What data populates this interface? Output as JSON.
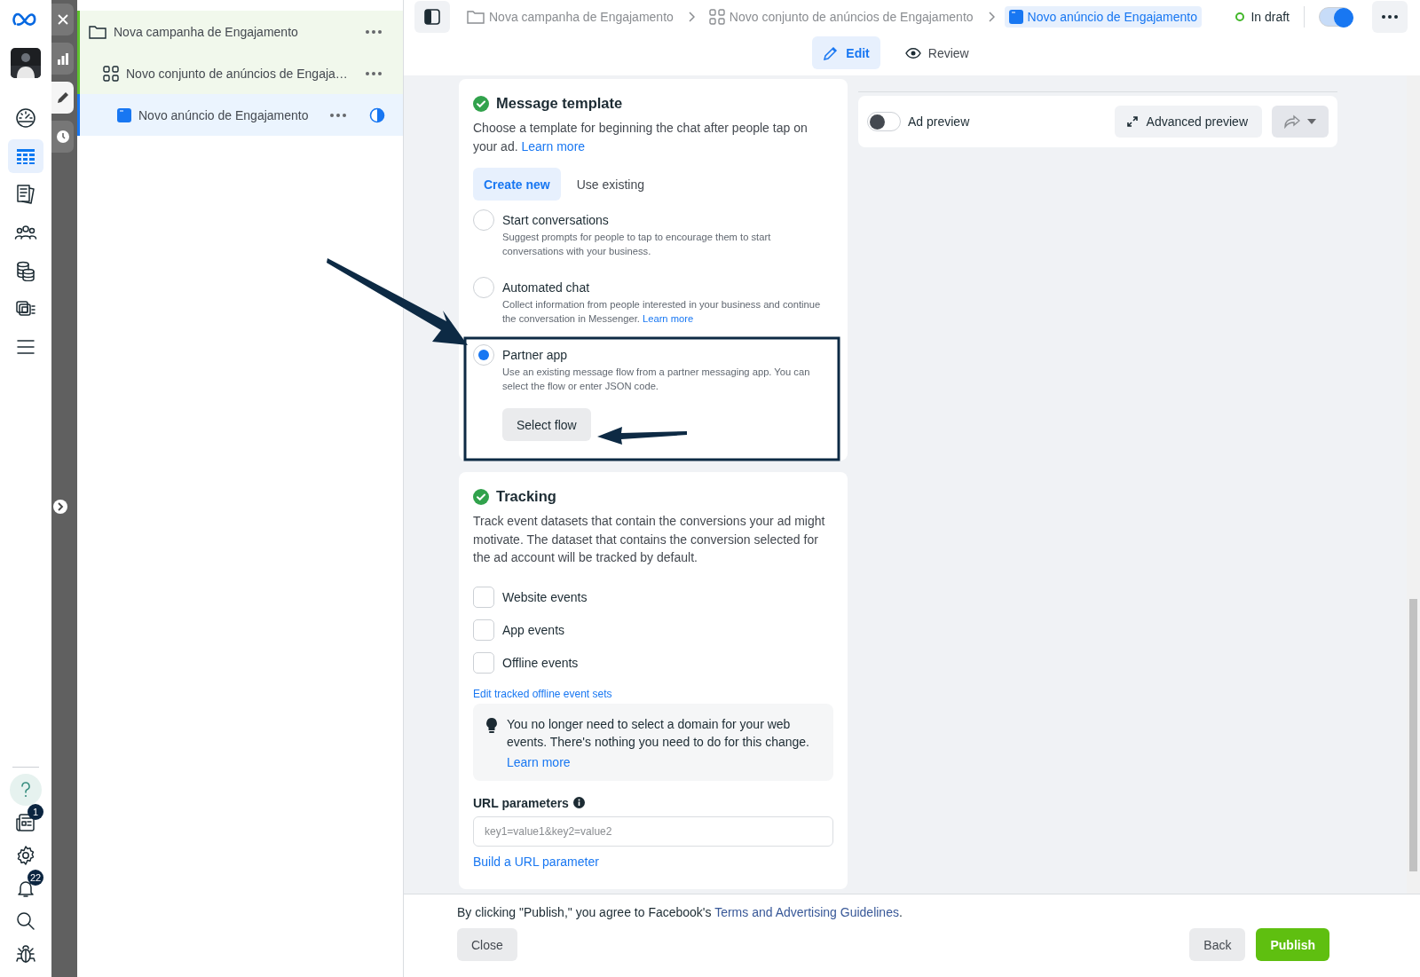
{
  "rail": {
    "items": [
      {
        "kind": "gauge",
        "selected": false
      },
      {
        "kind": "table",
        "selected": true
      },
      {
        "kind": "pages",
        "selected": false
      },
      {
        "kind": "people",
        "selected": false
      },
      {
        "kind": "coins",
        "selected": false
      },
      {
        "kind": "cards",
        "selected": false
      },
      {
        "kind": "menu",
        "selected": false
      }
    ],
    "bottom_items": [
      {
        "kind": "help"
      },
      {
        "kind": "news",
        "badge": "1"
      },
      {
        "kind": "gear"
      },
      {
        "kind": "bell",
        "badge": "22"
      },
      {
        "kind": "search"
      },
      {
        "kind": "bug"
      }
    ]
  },
  "tool_strip": {
    "items": [
      {
        "kind": "close",
        "selected": false
      },
      {
        "kind": "chart",
        "selected": false
      },
      {
        "kind": "pencil",
        "selected": true
      },
      {
        "kind": "clock",
        "selected": false
      }
    ]
  },
  "tree": [
    {
      "kind": "campaign",
      "label": "Nova campanha de Engajamento",
      "selected": false,
      "children": [
        {
          "kind": "adset",
          "label": "Novo conjunto de anúncios de Engaja…",
          "selected": false,
          "children": [
            {
              "kind": "ad",
              "label": "Novo anúncio de Engajamento",
              "selected": true
            }
          ]
        }
      ]
    }
  ],
  "breadcrumbs": [
    {
      "kind": "campaign",
      "label": "Nova campanha de Engajamento",
      "selected": false
    },
    {
      "kind": "adset",
      "label": "Novo conjunto de anúncios de Engajamento",
      "selected": false
    },
    {
      "kind": "ad",
      "label": "Novo anúncio de Engajamento",
      "selected": true
    }
  ],
  "status": {
    "label": "In draft",
    "on": true
  },
  "mode_tabs": [
    {
      "kind": "edit",
      "label": "Edit",
      "selected": true
    },
    {
      "kind": "review",
      "label": "Review",
      "selected": false
    }
  ],
  "message_template": {
    "title": "Message template",
    "complete": true,
    "description": "Choose a template for beginning the chat after people tap on your ad.",
    "link": "Learn more",
    "tabs": [
      {
        "label": "Create new",
        "selected": true
      },
      {
        "label": "Use existing",
        "selected": false
      }
    ],
    "options": [
      {
        "title": "Start conversations",
        "description": "Suggest prompts for people to tap to encourage them to start conversations with your business.",
        "selected": false
      },
      {
        "title": "Automated chat",
        "description": "Collect information from people interested in your business and continue the conversation in Messenger.",
        "link": "Learn more",
        "selected": false
      },
      {
        "title": "Partner app",
        "description": "Use an existing message flow from a partner messaging app. You can select the flow or enter JSON code.",
        "selected": true,
        "button": "Select flow"
      }
    ]
  },
  "tracking": {
    "title": "Tracking",
    "complete": true,
    "description": "Track event datasets that contain the conversions your ad might motivate. The dataset that contains the conversion selected for the ad account will be tracked by default.",
    "events": [
      {
        "label": "Website events",
        "checked": false
      },
      {
        "label": "App events",
        "checked": false
      },
      {
        "label": "Offline events",
        "checked": false
      }
    ],
    "link": "Edit tracked offline event sets",
    "notice": {
      "text": "You no longer need to select a domain for your web events. There's nothing you need to do for this change.",
      "link": "Learn more"
    },
    "url_parameters": {
      "label": "URL parameters",
      "placeholder": "key1=value1&key2=value2",
      "link": "Build a URL parameter"
    }
  },
  "preview": {
    "toggle_label": "Ad preview",
    "on": false,
    "advanced_button": "Advanced preview"
  },
  "footer": {
    "notice": "By clicking \"Publish,\" you agree to Facebook's",
    "link": "Terms and Advertising Guidelines",
    "notice_end": ".",
    "buttons": [
      {
        "kind": "secondary",
        "label": "Close"
      },
      {
        "kind": "secondary",
        "label": "Back"
      },
      {
        "kind": "primary",
        "label": "Publish"
      }
    ]
  },
  "annotations": [
    {
      "kind": "arrow"
    },
    {
      "kind": "frame"
    },
    {
      "kind": "arrow"
    }
  ]
}
